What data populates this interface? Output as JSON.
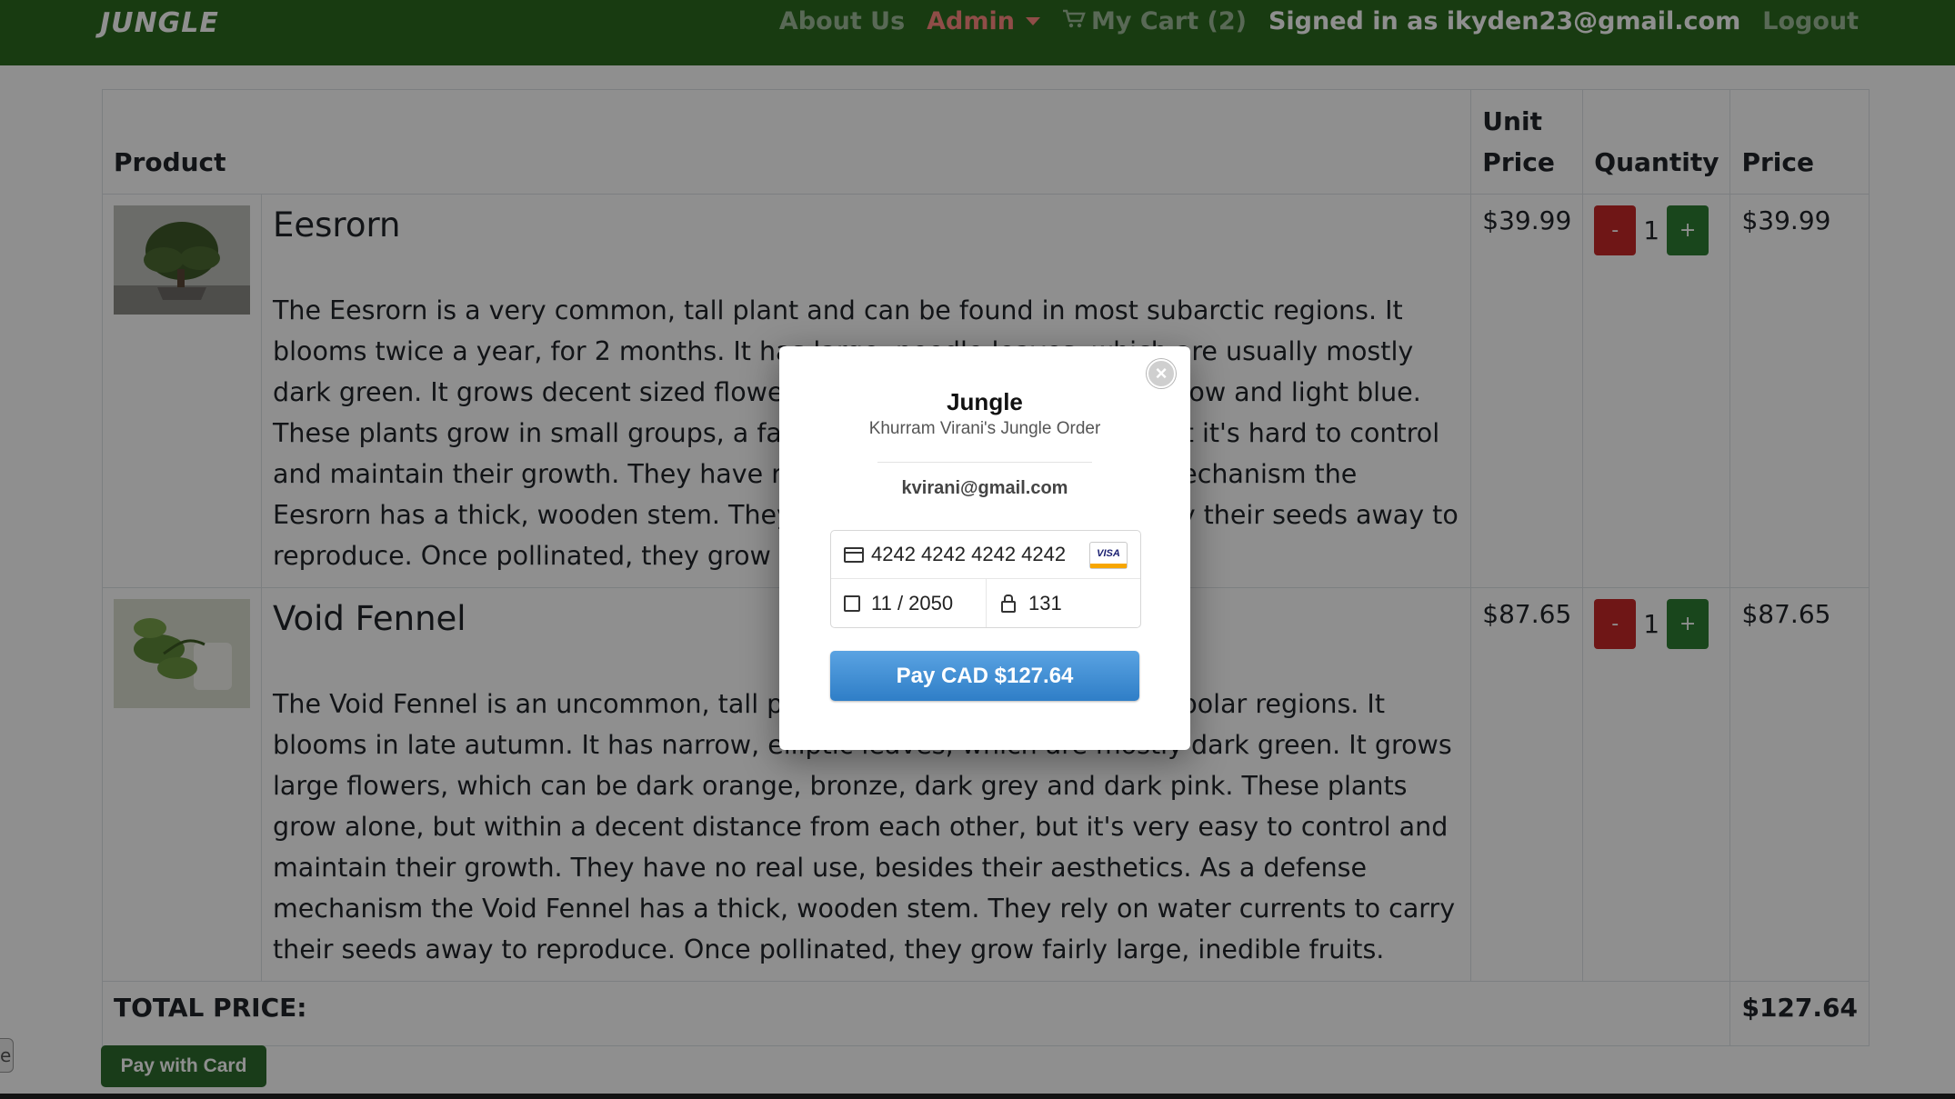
{
  "navbar": {
    "brand": "JUNGLE",
    "about": "About Us",
    "admin": "Admin",
    "cart": "My Cart (2)",
    "signed_in": "Signed in as ikyden23@gmail.com",
    "logout": "Logout"
  },
  "table": {
    "headers": {
      "product": "Product",
      "unit_price": "Unit Price",
      "quantity": "Quantity",
      "price": "Price"
    },
    "rows": [
      {
        "name": "Eesrorn",
        "description": "The Eesrorn is a very common, tall plant and can be found in most subarctic regions. It blooms twice a year, for 2 months. It has large, needle leaves, which are usually mostly dark green. It grows decent sized flowers, which can be light grey, yellow and light blue. These plants grow in small groups, a fair distance from each other, but it's hard to control and maintain their growth. They have no real use, but as a defense mechanism the Eesrorn has a thick, wooden stem. They rely on water currents to carry their seeds away to reproduce. Once pollinated, they grow fairly large, inedible fruits.",
        "unit_price": "$39.99",
        "minus": "-",
        "quantity": "1",
        "plus": "+",
        "price": "$39.99"
      },
      {
        "name": "Void Fennel",
        "description": "The Void Fennel is an uncommon, tall plant and can be found in most polar regions. It blooms in late autumn. It has narrow, elliptic leaves, which are mostly dark green. It grows large flowers, which can be dark orange, bronze, dark grey and dark pink. These plants grow alone, but within a decent distance from each other, but it's very easy to control and maintain their growth. They have no real use, besides their aesthetics. As a defense mechanism the Void Fennel has a thick, wooden stem. They rely on water currents to carry their seeds away to reproduce. Once pollinated, they grow fairly large, inedible fruits.",
        "unit_price": "$87.65",
        "minus": "-",
        "quantity": "1",
        "plus": "+",
        "price": "$87.65"
      }
    ],
    "total_label": "TOTAL PRICE:",
    "total_value": "$127.64"
  },
  "pay_with_card": "Pay with Card",
  "side_stub": "e",
  "checkout_modal": {
    "close": "×",
    "title": "Jungle",
    "subtitle": "Khurram Virani's Jungle Order",
    "email": "kvirani@gmail.com",
    "card_number": "4242 4242 4242 4242",
    "card_brand": "VISA",
    "expiry": "11 / 2050",
    "cvc": "131",
    "pay_button": "Pay CAD $127.64"
  },
  "colors": {
    "navbar_bg": "#2b6a1f",
    "admin_accent": "#ff8a80",
    "minus_button": "#c62828",
    "plus_button": "#2e7d32",
    "pay_button": "#3a8bd6"
  }
}
